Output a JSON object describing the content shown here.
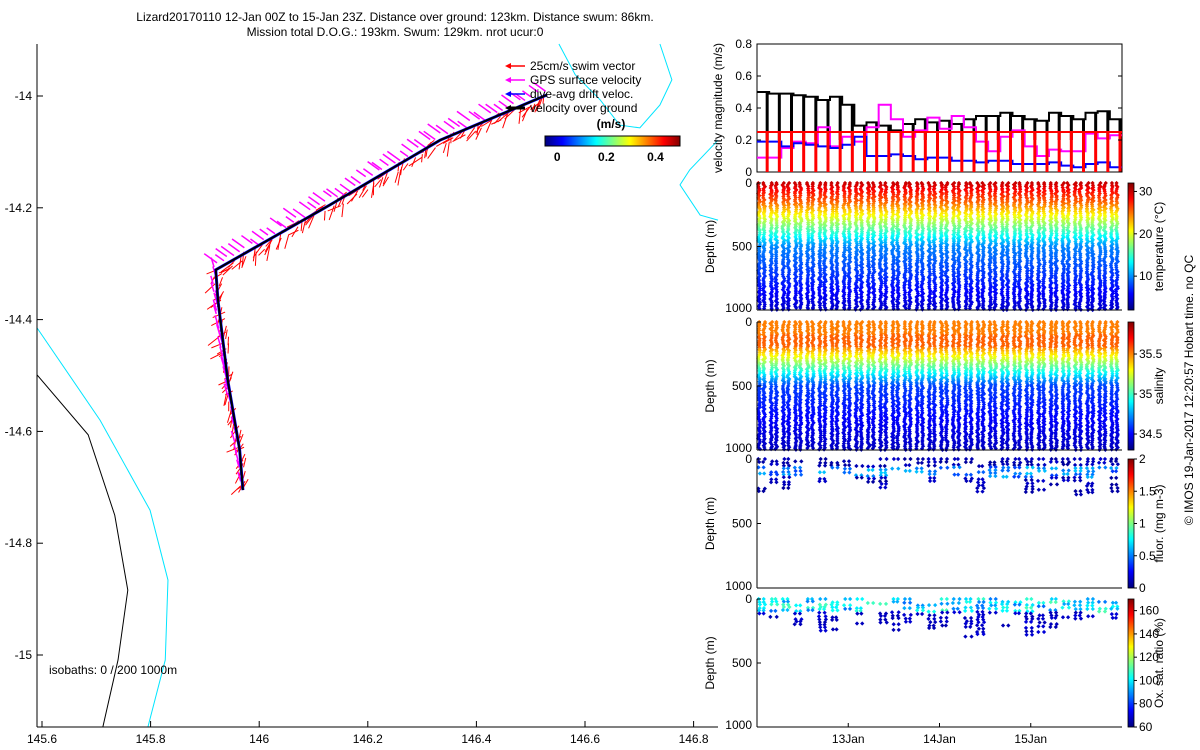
{
  "title": {
    "line1": "Lizard20170110 12-Jan 00Z to 15-Jan 23Z. Distance over ground: 123km. Distance swum: 86km.",
    "line2": "Mission total D.O.G.: 193km. Swum: 129km. nrot ucur:0"
  },
  "footer_credit": "© IMOS 19-Jan-2017 12:20:57 Hobart time. no QC",
  "chart_data": [
    {
      "type": "line",
      "panel": "map",
      "xlim": [
        145.59,
        146.845
      ],
      "ylim": [
        -15.13,
        -13.907
      ],
      "xticks": [
        145.6,
        145.8,
        146,
        146.2,
        146.4,
        146.6,
        146.8
      ],
      "xtick_labels": [
        "145.6",
        "145.8",
        "146",
        "146.2",
        "146.4",
        "146.6",
        "146.8"
      ],
      "yticks": [
        -14,
        -14.2,
        -14.4,
        -14.6,
        -14.8,
        -15
      ],
      "ytick_labels": [
        "-14",
        "-14.2",
        "-14.4",
        "-14.6",
        "-14.8",
        "-15"
      ],
      "legend": {
        "placement": "top-right",
        "entries": [
          {
            "label": "25cm/s swim vector",
            "color": "#ff0000"
          },
          {
            "label": "GPS surface velocity",
            "color": "#ff00ff"
          },
          {
            "label": "dive-avg drift veloc.",
            "color": "#0000ff"
          },
          {
            "label": "velocity over ground",
            "color": "#000000"
          }
        ]
      },
      "colorbar": {
        "label": "(m/s)",
        "range": [
          -0.05,
          0.5
        ],
        "ticks": [
          0,
          0.2,
          0.4
        ],
        "tick_labels": [
          "0",
          "0.2",
          "0.4"
        ],
        "colormap": "jet"
      },
      "isobath_label": "isobaths: 0 / 200  1000m",
      "track": {
        "lon": [
          146.53,
          146.333,
          146.13,
          145.92,
          145.924,
          145.942,
          145.964,
          145.97
        ],
        "lat": [
          -13.998,
          -14.079,
          -14.195,
          -14.311,
          -14.365,
          -14.508,
          -14.633,
          -14.705
        ]
      },
      "isobaths": [
        {
          "color": "#000000",
          "lon": [
            145.591,
            145.685,
            145.734,
            145.758,
            145.74,
            145.712
          ],
          "lat": [
            -14.499,
            -14.606,
            -14.75,
            -14.884,
            -15.009,
            -15.129
          ]
        },
        {
          "color": "#00e5ff",
          "lon": [
            145.591,
            145.707,
            145.799,
            145.832,
            145.827,
            145.795
          ],
          "lat": [
            -14.415,
            -14.58,
            -14.741,
            -14.866,
            -15.009,
            -15.129
          ]
        },
        {
          "color": "#00e5ff",
          "lon": [
            146.552,
            146.582,
            146.628,
            146.664,
            146.701,
            146.738,
            146.76,
            146.738
          ],
          "lat": [
            -13.907,
            -13.962,
            -14.007,
            -14.052,
            -14.057,
            -14.016,
            -13.971,
            -13.907
          ]
        },
        {
          "color": "#00e5ff",
          "lon": [
            146.845,
            146.793,
            146.775,
            146.812,
            146.845
          ],
          "lat": [
            -14.079,
            -14.132,
            -14.159,
            -14.213,
            -14.222
          ]
        }
      ]
    },
    {
      "type": "line",
      "panel": "velocity",
      "ylabel": "velocity magnitude (m/s)",
      "ylim": [
        0,
        0.8
      ],
      "yticks": [
        0,
        0.2,
        0.4,
        0.6,
        0.8
      ],
      "ytick_labels": [
        "0",
        "0.2",
        "0.4",
        "0.6",
        "0.8"
      ],
      "x_range_days": [
        "12Jan",
        "16Jan"
      ],
      "series": [
        {
          "color": "#000000",
          "values": [
            0.5,
            0.49,
            0.49,
            0.48,
            0.47,
            0.45,
            0.47,
            0.42,
            0.29,
            0.31,
            0.29,
            0.26,
            0.3,
            0.33,
            0.31,
            0.32,
            0.3,
            0.33,
            0.35,
            0.35,
            0.37,
            0.35,
            0.33,
            0.32,
            0.37,
            0.35,
            0.33,
            0.37,
            0.38,
            0.33
          ]
        },
        {
          "color": "#ff00ff",
          "values": [
            0.09,
            0.09,
            0.15,
            0.19,
            0.18,
            0.28,
            0.16,
            0.22,
            0.19,
            0.28,
            0.42,
            0.33,
            0.22,
            0.26,
            0.34,
            0.27,
            0.35,
            0.28,
            0.19,
            0.13,
            0.22,
            0.26,
            0.16,
            0.1,
            0.14,
            0.13,
            0.13,
            0.24,
            0.21,
            0.23
          ]
        },
        {
          "color": "#0000ff",
          "values": [
            0.19,
            0.19,
            0.16,
            0.18,
            0.17,
            0.16,
            0.15,
            0.17,
            0.22,
            0.1,
            0.1,
            0.11,
            0.1,
            0.08,
            0.09,
            0.09,
            0.07,
            0.07,
            0.06,
            0.07,
            0.07,
            0.05,
            0.05,
            0.05,
            0.06,
            0.04,
            0.03,
            0.05,
            0.06,
            0.03
          ]
        },
        {
          "color": "#ff0000",
          "values": [
            0.25,
            0.25,
            0.25,
            0.25,
            0.25,
            0.25,
            0.25,
            0.25,
            0.25,
            0.25,
            0.25,
            0.25,
            0.25,
            0.25,
            0.25,
            0.25,
            0.25,
            0.25,
            0.25,
            0.25,
            0.25,
            0.25,
            0.25,
            0.25,
            0.25,
            0.25,
            0.25,
            0.25,
            0.25,
            0.25
          ]
        }
      ]
    },
    {
      "type": "scatter",
      "panel": "temperature",
      "ylabel": "Depth (m)",
      "ylim": [
        1000,
        0
      ],
      "yticks": [
        0,
        500,
        1000
      ],
      "ytick_labels": [
        "0",
        "500",
        "1000"
      ],
      "max_depth": 1000,
      "surface_value": 30,
      "deep_value": 4,
      "colorbar": {
        "label": "temperature (°C)",
        "range": [
          2,
          32
        ],
        "ticks": [
          10,
          20,
          30
        ],
        "tick_labels": [
          "10",
          "20",
          "30"
        ],
        "colormap": "jet"
      }
    },
    {
      "type": "scatter",
      "panel": "salinity",
      "ylabel": "Depth (m)",
      "ylim": [
        1000,
        0
      ],
      "yticks": [
        0,
        500,
        1000
      ],
      "ytick_labels": [
        "0",
        "500",
        "1000"
      ],
      "max_depth": 1000,
      "surface_value": 35.5,
      "deep_value": 34.5,
      "colorbar": {
        "label": "salinity",
        "range": [
          34.3,
          35.9
        ],
        "ticks": [
          34.5,
          35,
          35.5
        ],
        "tick_labels": [
          "34.5",
          "35",
          "35.5"
        ],
        "colormap": "jet"
      }
    },
    {
      "type": "scatter",
      "panel": "fluorescence",
      "ylabel": "Depth (m)",
      "ylim": [
        1000,
        0
      ],
      "yticks": [
        0,
        500,
        1000
      ],
      "ytick_labels": [
        "0",
        "500",
        "1000"
      ],
      "max_depth": 300,
      "surface_value": 0.1,
      "deep_value": 0.05,
      "colorbar": {
        "label": "fluor. (mg m-3)",
        "range": [
          0,
          2
        ],
        "ticks": [
          0,
          0.5,
          1,
          1.5,
          2
        ],
        "tick_labels": [
          "0",
          "0.5",
          "1",
          "1.5",
          "2"
        ],
        "colormap": "jet"
      }
    },
    {
      "type": "scatter",
      "panel": "oxygen",
      "ylabel": "Depth (m)",
      "ylim": [
        1000,
        0
      ],
      "yticks": [
        0,
        500,
        1000
      ],
      "ytick_labels": [
        "0",
        "500",
        "1000"
      ],
      "max_depth": 300,
      "surface_value": 95,
      "deep_value": 65,
      "colorbar": {
        "label": "Ox. sat. ratio (%)",
        "range": [
          60,
          170
        ],
        "ticks": [
          60,
          80,
          100,
          120,
          140,
          160
        ],
        "tick_labels": [
          "60",
          "80",
          "100",
          "120",
          "140",
          "160"
        ],
        "colormap": "jet"
      },
      "xtick_labels": [
        "13Jan",
        "14Jan",
        "15Jan"
      ]
    }
  ]
}
